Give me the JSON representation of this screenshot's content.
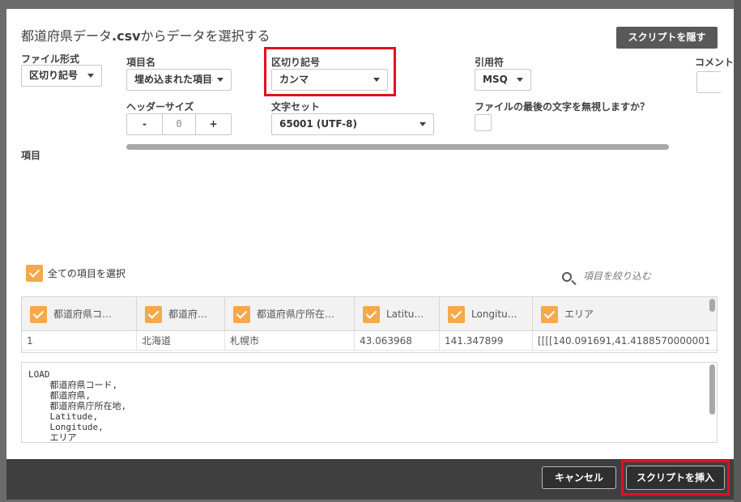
{
  "dialog": {
    "title_prefix": "都道府県データ",
    "title_ext": ".csv",
    "title_suffix": "からデータを選択する",
    "hide_script_label": "スクリプトを隠す"
  },
  "options": {
    "file_format": {
      "label": "ファイル形式",
      "value": "区切り記号"
    },
    "field_names": {
      "label": "項目名",
      "value": "埋め込まれた項目名"
    },
    "delimiter": {
      "label": "区切り記号",
      "value": "カンマ"
    },
    "quoting": {
      "label": "引用符",
      "value": "MSQ"
    },
    "comment": {
      "label": "コメント"
    },
    "header_size": {
      "label": "ヘッダーサイズ",
      "minus": "-",
      "value": "0",
      "plus": "+"
    },
    "charset": {
      "label": "文字セット",
      "value": "65001 (UTF-8)"
    },
    "ignore_eof": {
      "label": "ファイルの最後の文字を無視しますか？"
    }
  },
  "fields_label": "項目",
  "select_all_label": "全ての項目を選択",
  "filter_placeholder": "項目を絞り込む",
  "table": {
    "columns": [
      "都道府県コ…",
      "都道府…",
      "都道府県庁所在…",
      "Latitu…",
      "Longitu…",
      "エリア"
    ],
    "rows": [
      [
        "1",
        "北海道",
        "札幌市",
        "43.063968",
        "141.347899",
        "[[[[140.091691,41.4188570000001"
      ]
    ]
  },
  "script_text": "LOAD\n    都道府県コード,\n    都道府県,\n    都道府県庁所在地,\n    Latitude,\n    Longitude,\n    エリア",
  "footer": {
    "cancel_label": "キャンセル",
    "insert_label": "スクリプトを挿入"
  },
  "colors": {
    "accent_checkbox": "#f5a94b",
    "highlight": "#e3101e",
    "footer_bg": "#3f3f3f"
  }
}
